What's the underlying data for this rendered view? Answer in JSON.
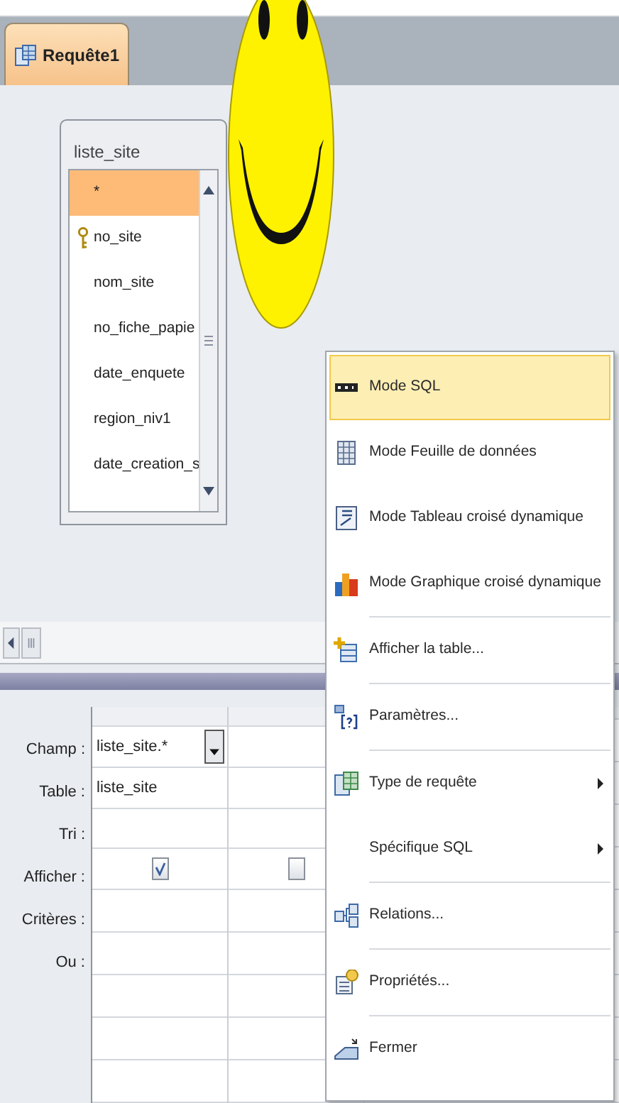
{
  "tab": {
    "label": "Requête1",
    "selected": true
  },
  "field_list": {
    "title": "liste_site",
    "fields": [
      {
        "name": "*",
        "selected": true,
        "primary_key": false
      },
      {
        "name": "no_site",
        "selected": false,
        "primary_key": true
      },
      {
        "name": "nom_site",
        "selected": false,
        "primary_key": false
      },
      {
        "name": "no_fiche_papie",
        "selected": false,
        "primary_key": false
      },
      {
        "name": "date_enquete",
        "selected": false,
        "primary_key": false
      },
      {
        "name": "region_niv1",
        "selected": false,
        "primary_key": false
      },
      {
        "name": "date_creation_s",
        "selected": false,
        "primary_key": false
      }
    ]
  },
  "grid": {
    "row_labels": [
      "Champ :",
      "Table :",
      "Tri :",
      "Afficher :",
      "Critères :",
      "Ou :"
    ],
    "columns": [
      {
        "field": "liste_site.*",
        "table": "liste_site",
        "show": true,
        "active": true
      },
      {
        "show": false
      }
    ]
  },
  "context_menu": {
    "items": [
      {
        "kind": "item",
        "label": "Mode SQL",
        "selected": true,
        "submenu": false
      },
      {
        "kind": "item",
        "label": "Mode Feuille de données",
        "selected": false,
        "submenu": false
      },
      {
        "kind": "item",
        "label": "Mode Tableau croisé dynamique",
        "selected": false,
        "submenu": false
      },
      {
        "kind": "item",
        "label": "Mode Graphique croisé dynamique",
        "selected": false,
        "submenu": false
      },
      {
        "kind": "separator"
      },
      {
        "kind": "item",
        "label": "Afficher la table...",
        "selected": false,
        "submenu": false
      },
      {
        "kind": "separator"
      },
      {
        "kind": "item",
        "label": "Paramètres...",
        "selected": false,
        "submenu": false
      },
      {
        "kind": "separator"
      },
      {
        "kind": "item",
        "label": "Type de requête",
        "selected": false,
        "submenu": true
      },
      {
        "kind": "item",
        "label": "Spécifique SQL",
        "selected": false,
        "submenu": true
      },
      {
        "kind": "separator"
      },
      {
        "kind": "item",
        "label": "Relations...",
        "selected": false,
        "submenu": false
      },
      {
        "kind": "separator"
      },
      {
        "kind": "item",
        "label": "Propriétés...",
        "selected": false,
        "submenu": false
      },
      {
        "kind": "separator"
      },
      {
        "kind": "item",
        "label": "Fermer",
        "selected": false,
        "submenu": false
      }
    ]
  }
}
